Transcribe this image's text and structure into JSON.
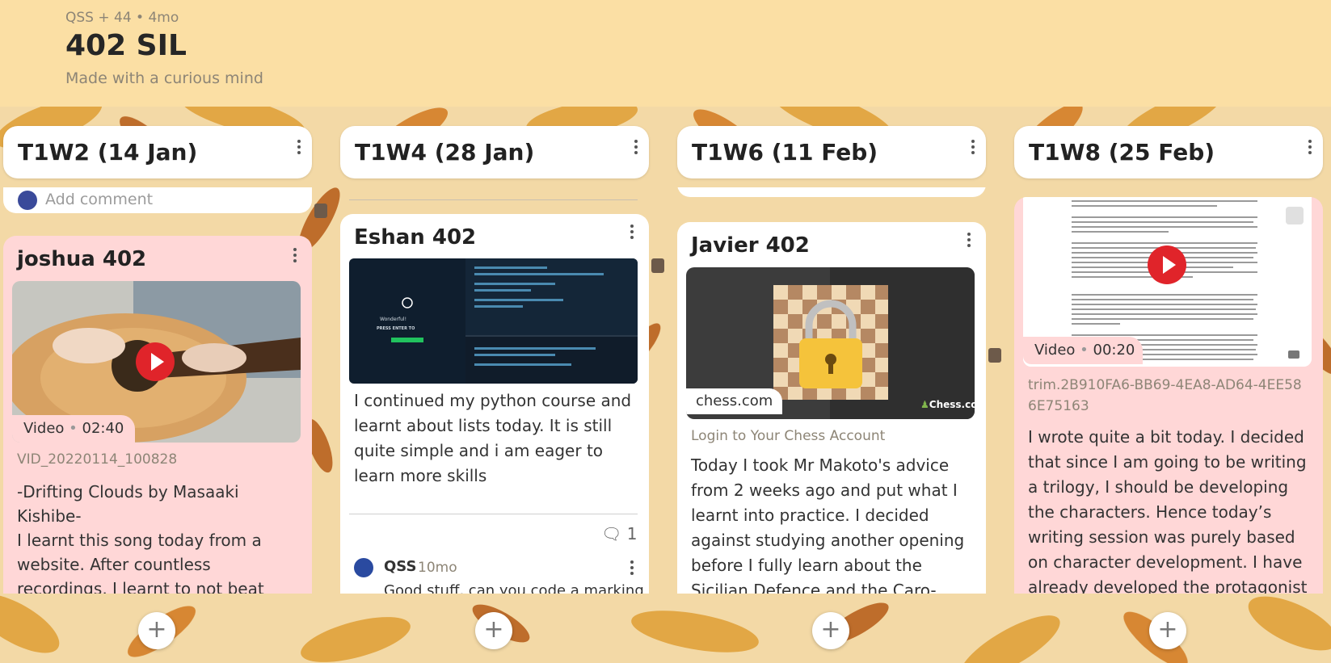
{
  "board": {
    "meta": "QSS + 44 • 4mo",
    "title": "402 SIL",
    "subtitle": "Made with a curious mind"
  },
  "columns": [
    {
      "title": "T1W2 (14 Jan)"
    },
    {
      "title": "T1W4 (28 Jan)"
    },
    {
      "title": "T1W6 (11 Feb)"
    },
    {
      "title": "T1W8 (25 Feb)"
    }
  ],
  "col1": {
    "prev_comment": "Add comment",
    "author": "joshua 402",
    "badge_kind": "Video",
    "badge_time": "02:40",
    "file": "VID_20220114_100828",
    "text1": "-Drifting Clouds by Masaaki Kishibe-",
    "text2": "I learnt this song today from a website. After countless recordings, I learnt to not beat"
  },
  "col2": {
    "author": "Eshan 402",
    "text": "I continued my python course and learnt about lists today. It is still quite simple and i am eager to learn more skills",
    "comment_count": "1",
    "commenter": "QSS",
    "comment_time": "10mo",
    "comment_text": "Good stuff, can you code a marking",
    "code_msg": "Wonderful!",
    "code_enter": "PRESS ENTER TO"
  },
  "col3": {
    "author": "Javier 402",
    "link_domain": "chess.com",
    "link_title": "Login to Your Chess Account",
    "brand": "Chess.com",
    "text": "Today I took Mr Makoto's advice from 2 weeks ago and put what I learnt into practice. I decided against studying another opening before I fully learn about the Sicilian Defence and the Caro-Kann"
  },
  "col4": {
    "badge_kind": "Video",
    "badge_time": "00:20",
    "file": "trim.2B910FA6-BB69-4EA8-AD64-4EE586E75163",
    "text": "I wrote quite a bit today. I decided that since I am going to be writing a trilogy, I should be developing the characters. Hence today’s writing session was purely based on character development. I have already developed the protagonist"
  },
  "add_label": "+",
  "colors": {
    "header_bg": "#fbdfa4",
    "card_pink": "#ffd7d7",
    "play_red": "#e0242a",
    "chess_green": "#81b64c"
  }
}
